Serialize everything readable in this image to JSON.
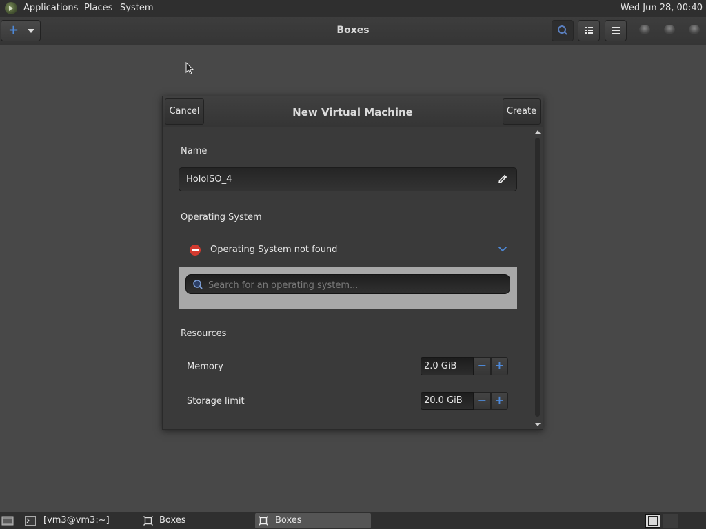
{
  "top_panel": {
    "menus": [
      "Applications",
      "Places",
      "System"
    ],
    "clock": "Wed Jun 28, 00:40"
  },
  "headerbar": {
    "title": "Boxes",
    "new_icon": "plus-icon",
    "buttons": [
      "search-icon",
      "list-view-icon",
      "hamburger-menu-icon"
    ]
  },
  "dialog": {
    "cancel_label": "Cancel",
    "title": "New Virtual Machine",
    "create_label": "Create",
    "name_label": "Name",
    "name_value": "HoloISO_4",
    "os_label": "Operating System",
    "os_status": "Operating System not found",
    "os_search_placeholder": "Search for an operating system...",
    "resources_label": "Resources",
    "memory_label": "Memory",
    "memory_value": "2.0 GiB",
    "storage_label": "Storage limit",
    "storage_value": "20.0 GiB",
    "stepper_minus": "−",
    "stepper_plus": "+"
  },
  "taskbar": {
    "tasks": [
      "[vm3@vm3:~]",
      "Boxes",
      "Boxes"
    ]
  },
  "colors": {
    "accent": "#4e89d8",
    "error": "#d33a2f",
    "background": "#484848"
  }
}
